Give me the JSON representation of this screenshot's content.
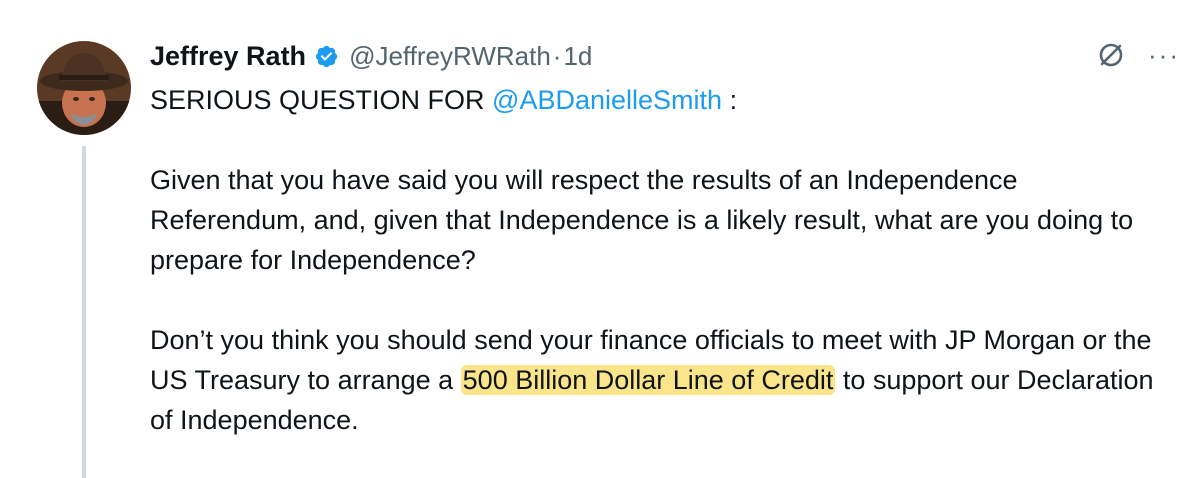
{
  "author": {
    "display_name": "Jeffrey Rath",
    "handle": "@JeffreyRWRath",
    "separator": "·",
    "time": "1d",
    "verified": true
  },
  "icons": {
    "verified": "verified-badge-icon",
    "grok": "grok-icon",
    "more": "more-options-icon"
  },
  "colors": {
    "mention": "#1d9bf0",
    "highlight": "#fbe58a",
    "verified": "#1d9bf0",
    "muted": "#536471"
  },
  "tweet": {
    "line1_prefix": "SERIOUS QUESTION FOR ",
    "mention": "@ABDanielleSmith",
    "line1_suffix": " :",
    "paragraph2": "Given that you have said you will respect the results of an Independence Referendum, and, given that Independence is a likely result, what are you doing to prepare for Independence?",
    "paragraph3_before": "Don’t you think you should send your finance officials to meet with JP Morgan or the US Treasury to arrange a ",
    "paragraph3_highlight": "500 Billion Dollar Line of Credit",
    "paragraph3_after": " to support our Declaration of Independence."
  },
  "more_label": "···"
}
